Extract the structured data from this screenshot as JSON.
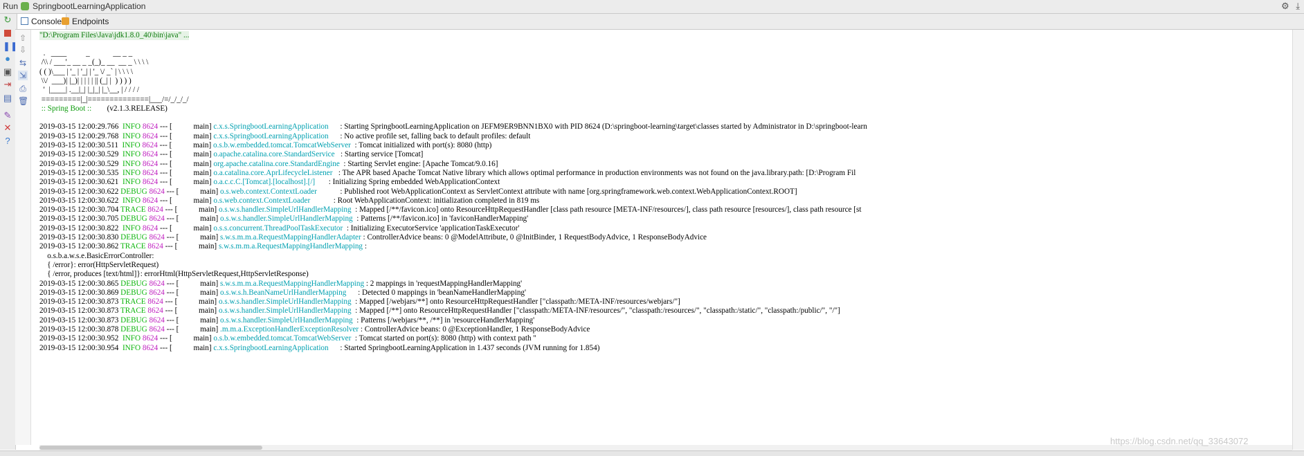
{
  "window": {
    "run_label": "Run",
    "app_title": "SpringbootLearningApplication"
  },
  "tabs": [
    {
      "label": "Console",
      "active": true
    },
    {
      "label": "Endpoints",
      "active": false
    }
  ],
  "icons": {
    "left_toolbar": [
      "rerun-icon",
      "stop-icon",
      "pause-icon",
      "debug-icon",
      "camera-icon",
      "exit-icon",
      "layout-icon",
      "pin-icon",
      "close-icon",
      "help-icon"
    ],
    "gutter_toolbar": [
      "up-arrow-icon",
      "down-arrow-icon",
      "soft-wrap-icon",
      "scroll-to-end-icon",
      "print-icon",
      "clear-icon"
    ],
    "title_right": [
      "gear-icon",
      "minimize-icon"
    ]
  },
  "console": {
    "command": "\"D:\\Program Files\\Java\\jdk1.8.0_40\\bin\\java\" ...",
    "banner": [
      "  .   ____          _            __ _ _",
      " /\\\\ / ___'_ __ _ _(_)_ __  __ _ \\ \\ \\ \\",
      "( ( )\\___ | '_ | '_| | '_ \\/ _` | \\ \\ \\ \\",
      " \\\\/  ___)| |_)| | | | | || (_| |  ) ) ) )",
      "  '  |____| .__|_| |_|_| |_\\__, | / / / /",
      " =========|_|==============|___/=/_/_/_/"
    ],
    "spring_boot_label": " :: Spring Boot :: ",
    "spring_boot_version": "       (v2.1.3.RELEASE)",
    "logs": [
      {
        "ts": "2019-03-15 12:00:29.766",
        "level": " INFO",
        "pid": "8624",
        "thread": "--- [           main]",
        "logger": "c.x.s.SpringbootLearningApplication     ",
        "msg": ": Starting SpringbootLearningApplication on JEFM9ER9BNN1BX0 with PID 8624 (D:\\springboot-learning\\target\\classes started by Administrator in D:\\springboot-learn"
      },
      {
        "ts": "2019-03-15 12:00:29.768",
        "level": " INFO",
        "pid": "8624",
        "thread": "--- [           main]",
        "logger": "c.x.s.SpringbootLearningApplication     ",
        "msg": ": No active profile set, falling back to default profiles: default"
      },
      {
        "ts": "2019-03-15 12:00:30.511",
        "level": " INFO",
        "pid": "8624",
        "thread": "--- [           main]",
        "logger": "o.s.b.w.embedded.tomcat.TomcatWebServer ",
        "msg": ": Tomcat initialized with port(s): 8080 (http)"
      },
      {
        "ts": "2019-03-15 12:00:30.529",
        "level": " INFO",
        "pid": "8624",
        "thread": "--- [           main]",
        "logger": "o.apache.catalina.core.StandardService  ",
        "msg": ": Starting service [Tomcat]"
      },
      {
        "ts": "2019-03-15 12:00:30.529",
        "level": " INFO",
        "pid": "8624",
        "thread": "--- [           main]",
        "logger": "org.apache.catalina.core.StandardEngine ",
        "msg": ": Starting Servlet engine: [Apache Tomcat/9.0.16]"
      },
      {
        "ts": "2019-03-15 12:00:30.535",
        "level": " INFO",
        "pid": "8624",
        "thread": "--- [           main]",
        "logger": "o.a.catalina.core.AprLifecycleListener  ",
        "msg": ": The APR based Apache Tomcat Native library which allows optimal performance in production environments was not found on the java.library.path: [D:\\Program Fil"
      },
      {
        "ts": "2019-03-15 12:00:30.621",
        "level": " INFO",
        "pid": "8624",
        "thread": "--- [           main]",
        "logger": "o.a.c.c.C.[Tomcat].[localhost].[/]      ",
        "msg": ": Initializing Spring embedded WebApplicationContext"
      },
      {
        "ts": "2019-03-15 12:00:30.622",
        "level": "DEBUG",
        "pid": "8624",
        "thread": "--- [           main]",
        "logger": "o.s.web.context.ContextLoader           ",
        "msg": ": Published root WebApplicationContext as ServletContext attribute with name [org.springframework.web.context.WebApplicationContext.ROOT]"
      },
      {
        "ts": "2019-03-15 12:00:30.622",
        "level": " INFO",
        "pid": "8624",
        "thread": "--- [           main]",
        "logger": "o.s.web.context.ContextLoader           ",
        "msg": ": Root WebApplicationContext: initialization completed in 819 ms"
      },
      {
        "ts": "2019-03-15 12:00:30.704",
        "level": "TRACE",
        "pid": "8624",
        "thread": "--- [           main]",
        "logger": "o.s.w.s.handler.SimpleUrlHandlerMapping ",
        "msg": ": Mapped [/**/favicon.ico] onto ResourceHttpRequestHandler [class path resource [META-INF/resources/], class path resource [resources/], class path resource [st"
      },
      {
        "ts": "2019-03-15 12:00:30.705",
        "level": "DEBUG",
        "pid": "8624",
        "thread": "--- [           main]",
        "logger": "o.s.w.s.handler.SimpleUrlHandlerMapping ",
        "msg": ": Patterns [/**/favicon.ico] in 'faviconHandlerMapping'"
      },
      {
        "ts": "2019-03-15 12:00:30.822",
        "level": " INFO",
        "pid": "8624",
        "thread": "--- [           main]",
        "logger": "o.s.s.concurrent.ThreadPoolTaskExecutor ",
        "msg": ": Initializing ExecutorService 'applicationTaskExecutor'"
      },
      {
        "ts": "2019-03-15 12:00:30.830",
        "level": "DEBUG",
        "pid": "8624",
        "thread": "--- [           main]",
        "logger": "s.w.s.m.m.a.RequestMappingHandlerAdapter",
        "msg": ": ControllerAdvice beans: 0 @ModelAttribute, 0 @InitBinder, 1 RequestBodyAdvice, 1 ResponseBodyAdvice"
      },
      {
        "ts": "2019-03-15 12:00:30.862",
        "level": "TRACE",
        "pid": "8624",
        "thread": "--- [           main]",
        "logger": "s.w.s.m.m.a.RequestMappingHandlerMapping",
        "msg": ": "
      }
    ],
    "continuation": [
      "    o.s.b.a.w.s.e.BasicErrorController:",
      "    { /error}: error(HttpServletRequest)",
      "    { /error, produces [text/html]}: errorHtml(HttpServletRequest,HttpServletResponse)"
    ],
    "logs2": [
      {
        "ts": "2019-03-15 12:00:30.865",
        "level": "DEBUG",
        "pid": "8624",
        "thread": "--- [           main]",
        "logger": "s.w.s.m.m.a.RequestMappingHandlerMapping",
        "msg": ": 2 mappings in 'requestMappingHandlerMapping'"
      },
      {
        "ts": "2019-03-15 12:00:30.869",
        "level": "DEBUG",
        "pid": "8624",
        "thread": "--- [           main]",
        "logger": "o.s.w.s.h.BeanNameUrlHandlerMapping     ",
        "msg": ": Detected 0 mappings in 'beanNameHandlerMapping'"
      },
      {
        "ts": "2019-03-15 12:00:30.873",
        "level": "TRACE",
        "pid": "8624",
        "thread": "--- [           main]",
        "logger": "o.s.w.s.handler.SimpleUrlHandlerMapping ",
        "msg": ": Mapped [/webjars/**] onto ResourceHttpRequestHandler [\"classpath:/META-INF/resources/webjars/\"]"
      },
      {
        "ts": "2019-03-15 12:00:30.873",
        "level": "TRACE",
        "pid": "8624",
        "thread": "--- [           main]",
        "logger": "o.s.w.s.handler.SimpleUrlHandlerMapping ",
        "msg": ": Mapped [/**] onto ResourceHttpRequestHandler [\"classpath:/META-INF/resources/\", \"classpath:/resources/\", \"classpath:/static/\", \"classpath:/public/\", \"/\"]"
      },
      {
        "ts": "2019-03-15 12:00:30.873",
        "level": "DEBUG",
        "pid": "8624",
        "thread": "--- [           main]",
        "logger": "o.s.w.s.handler.SimpleUrlHandlerMapping ",
        "msg": ": Patterns [/webjars/**, /**] in 'resourceHandlerMapping'"
      },
      {
        "ts": "2019-03-15 12:00:30.878",
        "level": "DEBUG",
        "pid": "8624",
        "thread": "--- [           main]",
        "logger": ".m.m.a.ExceptionHandlerExceptionResolver",
        "msg": ": ControllerAdvice beans: 0 @ExceptionHandler, 1 ResponseBodyAdvice"
      },
      {
        "ts": "2019-03-15 12:00:30.952",
        "level": " INFO",
        "pid": "8624",
        "thread": "--- [           main]",
        "logger": "o.s.b.w.embedded.tomcat.TomcatWebServer ",
        "msg": ": Tomcat started on port(s): 8080 (http) with context path ''"
      },
      {
        "ts": "2019-03-15 12:00:30.954",
        "level": " INFO",
        "pid": "8624",
        "thread": "--- [           main]",
        "logger": "c.x.s.SpringbootLearningApplication     ",
        "msg": ": Started SpringbootLearningApplication in 1.437 seconds (JVM running for 1.854)"
      }
    ]
  },
  "watermark": "https://blog.csdn.net/qq_33643072",
  "colors": {
    "level": "#0ab40a",
    "pid": "#c020c0",
    "logger": "#00a0b0",
    "command": "#0a7a0a"
  }
}
